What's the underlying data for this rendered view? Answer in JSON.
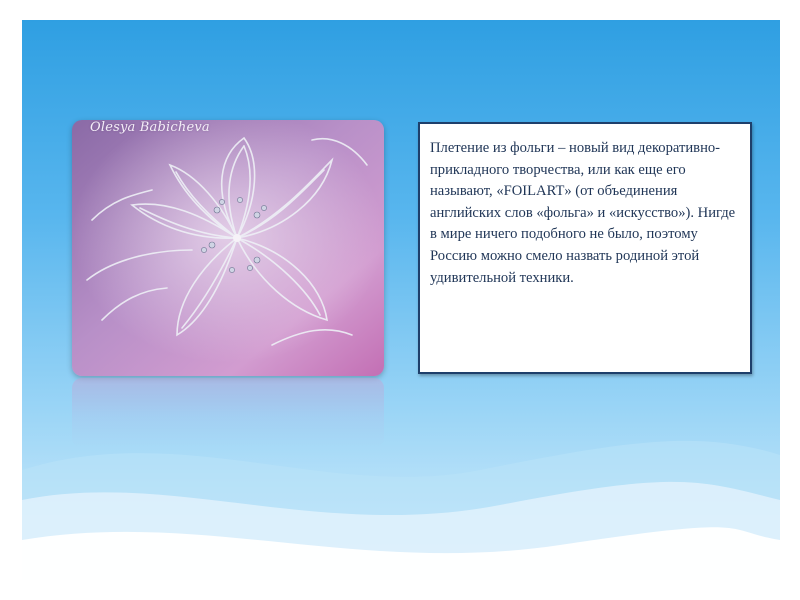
{
  "slide": {
    "watermark": "Olesya Babicheva",
    "description": "Плетение из фольги – новый вид декоративно-прикладного творчества, или как еще его называют, «FOILART» (от объединения английских слов «фольга» и «искусство»). Нигде в мире ничего подобного не было, поэтому Россию можно смело назвать родиной этой удивительной техники."
  },
  "colors": {
    "background_top": "#2f9fe2",
    "background_bottom": "#d6eefb",
    "text": "#1f3556",
    "textbox_border": "#1e3f6b"
  },
  "icons": {
    "photo": "foil-flower-image"
  }
}
